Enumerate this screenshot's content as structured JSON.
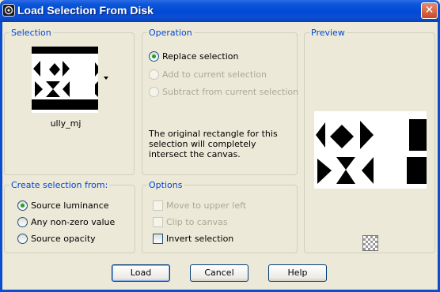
{
  "window": {
    "title": "Load Selection From Disk",
    "close_symbol": "✕",
    "app_icon": "paint-shop-pro-icon"
  },
  "selection": {
    "legend": "Selection",
    "file_name": "ully_mj"
  },
  "operation": {
    "legend": "Operation",
    "options": [
      {
        "label": "Replace selection",
        "checked": true,
        "enabled": true
      },
      {
        "label": "Add to current selection",
        "checked": false,
        "enabled": false
      },
      {
        "label": "Subtract from current selection",
        "checked": false,
        "enabled": false
      }
    ],
    "description": "The original rectangle for this selection will completely intersect the canvas."
  },
  "preview": {
    "legend": "Preview",
    "transparency_icon": "checkerboard-icon"
  },
  "create_from": {
    "legend": "Create selection from:",
    "options": [
      {
        "label": "Source luminance",
        "checked": true
      },
      {
        "label": "Any non-zero value",
        "checked": false
      },
      {
        "label": "Source opacity",
        "checked": false
      }
    ]
  },
  "options": {
    "legend": "Options",
    "items": [
      {
        "label": "Move to upper left",
        "checked": false,
        "enabled": false
      },
      {
        "label": "Clip to canvas",
        "checked": false,
        "enabled": false
      },
      {
        "label": "Invert selection",
        "checked": false,
        "enabled": true
      }
    ]
  },
  "buttons": {
    "load": "Load",
    "cancel": "Cancel",
    "help": "Help"
  },
  "colors": {
    "titlebar": "#0a56d8",
    "dialog_bg": "#ece9d8",
    "legend_text": "#0046d5",
    "radio_dot": "#21a121"
  }
}
